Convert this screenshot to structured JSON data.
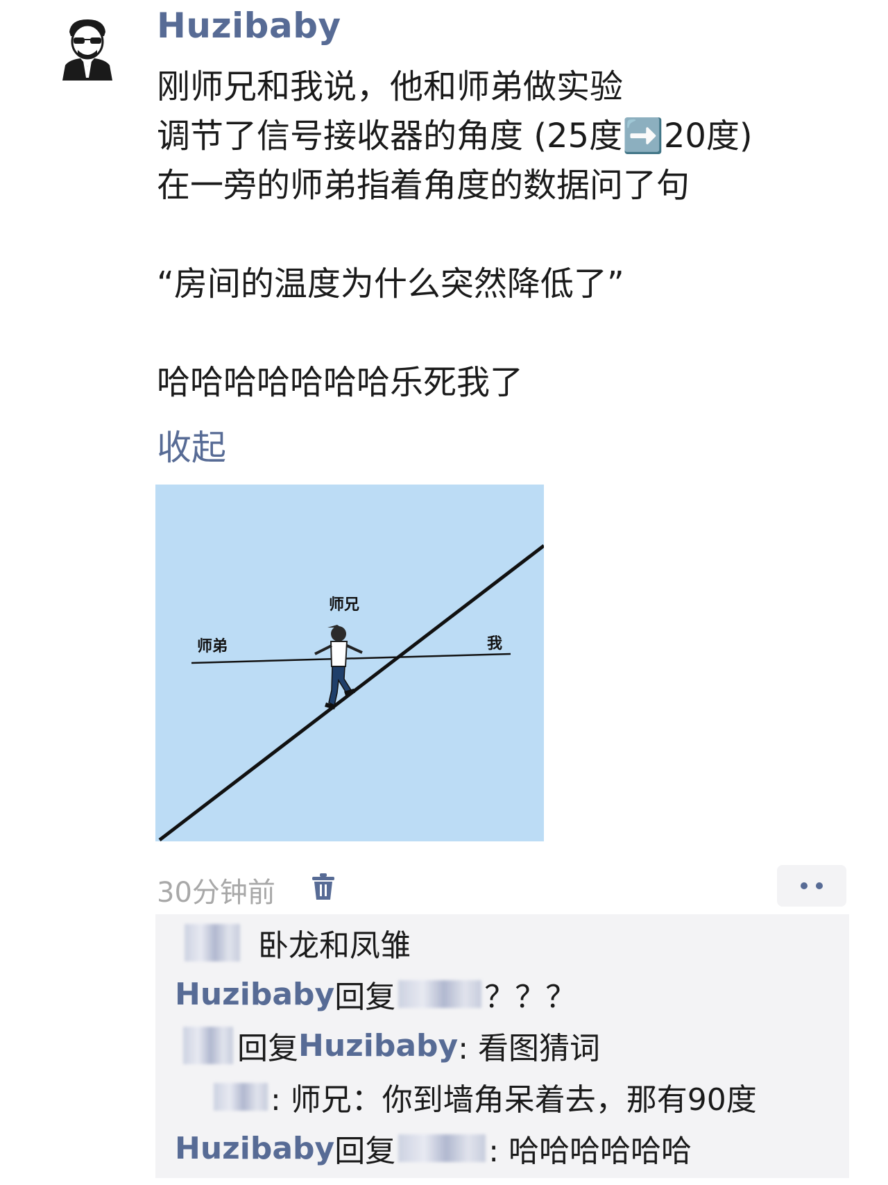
{
  "post": {
    "username": "Huzibaby",
    "text": "刚师兄和我说，他和师弟做实验\n调节了信号接收器的角度 (25度➡️20度)\n在一旁的师弟指着角度的数据问了句\n\n“房间的温度为什么突然降低了”\n\n哈哈哈哈哈哈哈乐死我了",
    "collapse_label": "收起",
    "image": {
      "label_junior": "师弟",
      "label_senior": "师兄",
      "label_me": "我"
    },
    "time": "30分钟前",
    "delete_icon": "trash-icon",
    "more_icon": "ellipsis-icon"
  },
  "comments": [
    {
      "type": "like",
      "text": "卧龙和凤雏"
    },
    {
      "from": "Huzibaby",
      "reply_word": "回复",
      "text": "？？？"
    },
    {
      "reply_word": "回复",
      "to": "Huzibaby",
      "text": ": 看图猜词"
    },
    {
      "text": ": 师兄：你到墙角呆着去，那有90度"
    },
    {
      "from": "Huzibaby",
      "reply_word": "回复",
      "text": ": 哈哈哈哈哈哈"
    }
  ],
  "colors": {
    "nickname": "#576b95",
    "comment_bg": "#f3f3f5",
    "image_bg": "#bcdcf5",
    "time": "#a8a8a8"
  }
}
